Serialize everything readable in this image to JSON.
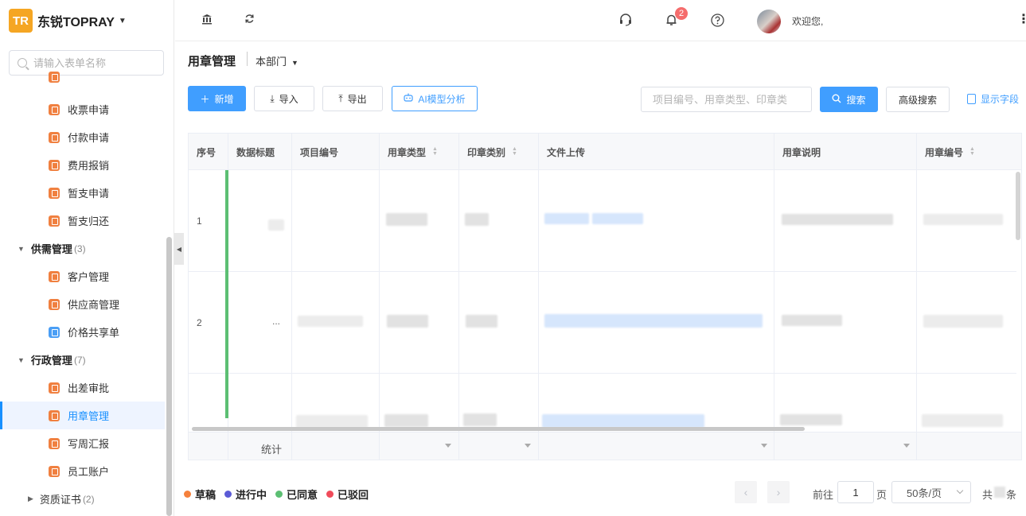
{
  "sidebar": {
    "logo_text": "TR",
    "brand": "东锐TOPRAY",
    "search_placeholder": "请输入表单名称",
    "items": [
      {
        "label": "收票申请"
      },
      {
        "label": "付款申请"
      },
      {
        "label": "费用报销"
      },
      {
        "label": "暂支申请"
      },
      {
        "label": "暂支归还"
      },
      {
        "label": "客户管理"
      },
      {
        "label": "供应商管理"
      },
      {
        "label": "价格共享单"
      },
      {
        "label": "出差审批"
      },
      {
        "label": "用章管理"
      },
      {
        "label": "写周汇报"
      },
      {
        "label": "员工账户"
      }
    ],
    "groups": [
      {
        "label": "供需管理",
        "count": "(3)"
      },
      {
        "label": "行政管理",
        "count": "(7)"
      },
      {
        "label": "资质证书",
        "count": "(2)"
      }
    ]
  },
  "topbar": {
    "notification_count": "2",
    "welcome": "欢迎您,"
  },
  "page": {
    "title": "用章管理",
    "department": "本部门"
  },
  "toolbar": {
    "add": "新增",
    "import": "导入",
    "export": "导出",
    "ai_analysis": "AI模型分析",
    "search_placeholder": "项目编号、用章类型、印章类",
    "search": "搜索",
    "advanced_search": "高级搜索",
    "show_fields": "显示字段"
  },
  "table": {
    "columns": [
      "序号",
      "数据标题",
      "项目编号",
      "用章类型",
      "印章类别",
      "文件上传",
      "用章说明",
      "用章编号"
    ],
    "rows": [
      {
        "index": "1",
        "title": ""
      },
      {
        "index": "2",
        "title": "..."
      },
      {
        "index": "",
        "title": ""
      }
    ],
    "footer_label": "统计"
  },
  "legend": [
    {
      "label": "草稿",
      "color": "#f5813c"
    },
    {
      "label": "进行中",
      "color": "#5b5bd6"
    },
    {
      "label": "已同意",
      "color": "#5cbf73"
    },
    {
      "label": "已驳回",
      "color": "#f04b5a"
    }
  ],
  "pagination": {
    "goto_label": "前往",
    "page": "1",
    "page_suffix": "页",
    "page_size": "50条/页",
    "total_prefix": "共",
    "total_suffix": "条"
  }
}
